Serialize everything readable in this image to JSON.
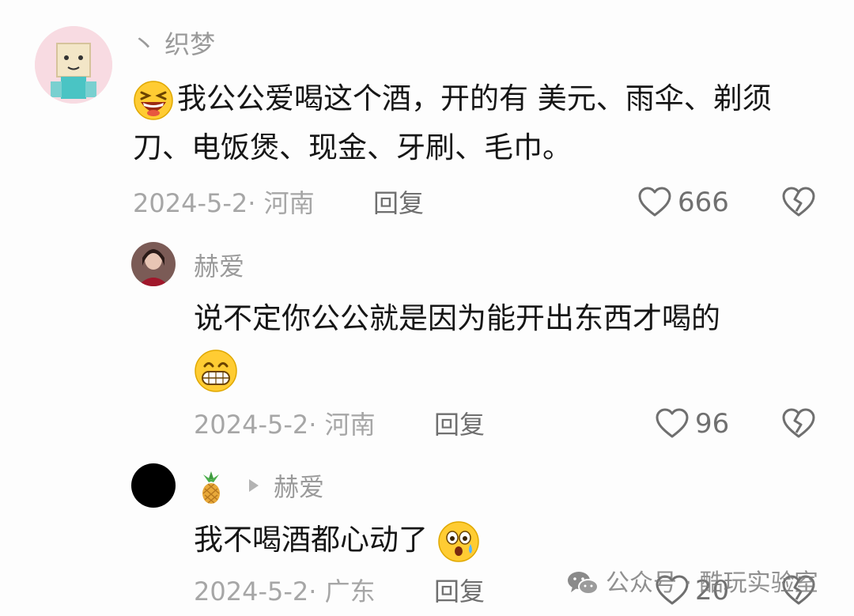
{
  "comments": [
    {
      "username": "丶 织梦",
      "text_before_emoji": "",
      "text": "我公公爱喝这个酒，开的有 美元、雨伞、剃须刀、电饭煲、现金、牙刷、毛巾。",
      "emoji": "laughing-face-emoji",
      "date_location": "2024-5-2· 河南",
      "reply_label": "回复",
      "like_count": "666"
    },
    {
      "username": "赫爱",
      "text": "说不定你公公就是因为能开出东西才喝的",
      "emoji": "grinning-face-emoji",
      "date_location": "2024-5-2· 河南",
      "reply_label": "回复",
      "like_count": "96"
    },
    {
      "username_emoji": "pineapple-emoji",
      "reply_to": "赫爱",
      "text": "我不喝酒都心动了",
      "emoji": "astonished-face-emoji",
      "date_location": "2024-5-2· 广东",
      "reply_label": "回复",
      "like_count": "20"
    }
  ],
  "watermark": {
    "label": "公众号 · 酷玩实验室",
    "icon": "wechat-icon"
  },
  "colors": {
    "background": "#fdfdfd",
    "text": "#161616",
    "meta": "#a6a6a6",
    "emoji_yellow": "#ffcc33"
  }
}
